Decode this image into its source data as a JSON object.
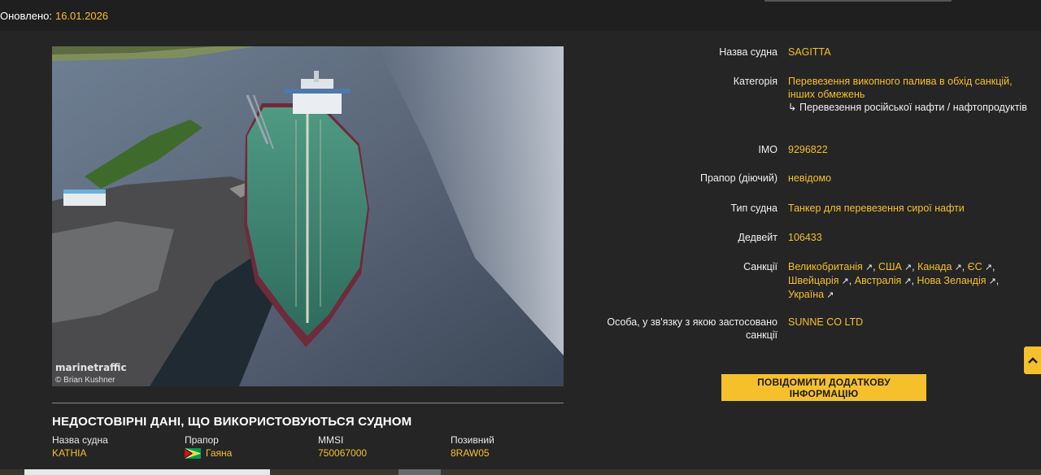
{
  "header": {
    "updated_label": "Оновлено:",
    "updated_value": "16.01.2026"
  },
  "photo": {
    "alt": "SAGITTA",
    "watermark": "marinetraffic",
    "credit": "© Brian Kushner"
  },
  "unreliable": {
    "title": "НЕДОСТОВІРНІ ДАНІ, ЩО ВИКОРИСТОВУЮТЬСЯ СУДНОМ",
    "columns": [
      {
        "label": "Назва судна",
        "value": "KATHIA"
      },
      {
        "label": "Прапор",
        "value": "Гаяна",
        "flag_icon": "guyana-flag-icon"
      },
      {
        "label": "MMSI",
        "value": "750067000"
      },
      {
        "label": "Позивний",
        "value": "8RAW05"
      }
    ]
  },
  "info": {
    "name_label": "Назва судна",
    "name_value": "SAGITTA",
    "category_label": "Категорія",
    "category_value": "Перевезення викопного палива в обхід санкцій, інших обмежень",
    "category_sub": "Перевезення російської нафти / нафтопродуктів",
    "category_sub_prefix": "↳",
    "imo_label": "IMO",
    "imo_value": "9296822",
    "flag_label": "Прапор (діючий)",
    "flag_value": "невідомо",
    "type_label": "Тип судна",
    "type_value": "Танкер для перевезення сирої нафти",
    "dwt_label": "Дедвейт",
    "dwt_value": "106433",
    "sanctions_label": "Санкції",
    "sanctions": [
      "Великобританія",
      "США",
      "Канада",
      "ЄС",
      "Швейцарія",
      "Австралія",
      "Нова Зеландія",
      "Україна"
    ],
    "person_label": "Особа, у зв'язку з якою застосовано санкції",
    "person_value": "SUNNE CO LTD"
  },
  "report_button": "ПОВІДОМИТИ ДОДАТКОВУ ІНФОРМАЦІЮ",
  "colors": {
    "accent": "#f5c02c",
    "background": "#252525",
    "topbar": "#1f1f1f"
  }
}
